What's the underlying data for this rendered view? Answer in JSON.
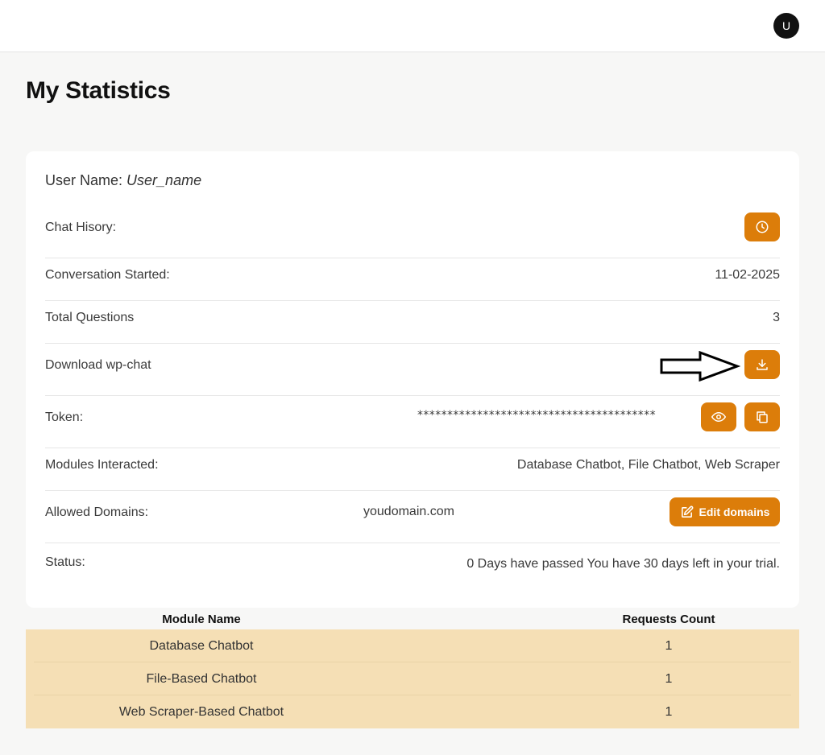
{
  "header": {
    "avatar_initial": "U"
  },
  "page": {
    "title": "My Statistics"
  },
  "stats": {
    "username_label": "User Name:",
    "username_value": "User_name",
    "chat_history_label": "Chat Hisory:",
    "conversation_started_label": "Conversation Started:",
    "conversation_started_value": "11-02-2025",
    "total_questions_label": "Total Questions",
    "total_questions_value": "3",
    "download_label": "Download wp-chat",
    "token_label": "Token:",
    "token_masked": "****************************************",
    "modules_label": "Modules Interacted:",
    "modules_value": "Database Chatbot, File Chatbot, Web Scraper",
    "domains_label": "Allowed Domains:",
    "domains_value": "youdomain.com",
    "edit_domains_label": "Edit domains",
    "status_label": "Status:",
    "status_value": "0 Days have passed You have 30 days left in your trial."
  },
  "icons": {
    "chat_history": "clock-icon",
    "download": "download-icon",
    "token_view": "eye-icon",
    "token_copy": "copy-icon",
    "edit": "edit-icon",
    "annotation": "arrow-right-icon"
  },
  "colors": {
    "accent": "#dc7d0a",
    "table_row": "#f5dfb5"
  },
  "table": {
    "headers": [
      "Module Name",
      "Requests Count"
    ],
    "rows": [
      [
        "Database Chatbot",
        "1"
      ],
      [
        "File-Based Chatbot",
        "1"
      ],
      [
        "Web Scraper-Based Chatbot",
        "1"
      ]
    ]
  }
}
